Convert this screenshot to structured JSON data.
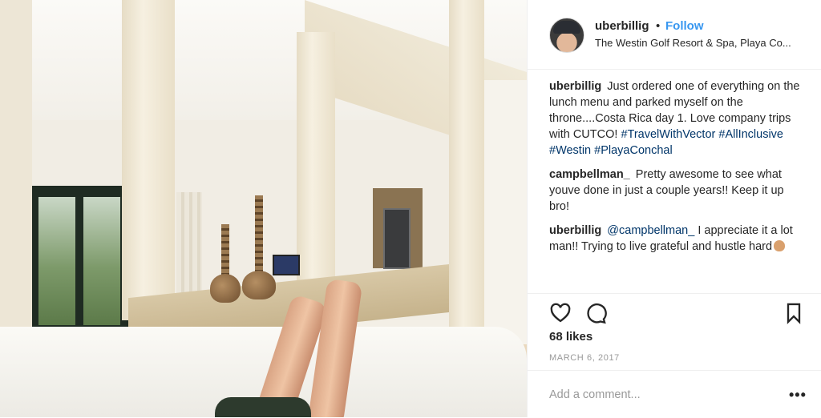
{
  "post": {
    "author": {
      "username": "uberbillig",
      "follow_label": "Follow",
      "location": "The Westin Golf Resort & Spa, Playa Co..."
    },
    "separator": "•",
    "caption": {
      "author": "uberbillig",
      "text": "Just ordered one of everything on the lunch menu and parked myself on the throne....Costa Rica day 1. Love company trips with CUTCO!",
      "hashtags": [
        "#TravelWithVector",
        "#AllInclusive",
        "#Westin",
        "#PlayaConchal"
      ]
    },
    "comments": [
      {
        "author": "campbellman_",
        "text": "Pretty awesome to see what youve done in just a couple years!! Keep it up bro!"
      },
      {
        "author": "uberbillig",
        "mention": "@campbellman_",
        "text": "I appreciate it a lot man!! Trying to live grateful and hustle hard",
        "emoji": "ok-hand-emoji"
      }
    ],
    "likes_text": "68 likes",
    "date_text": "MARCH 6, 2017",
    "add_comment_placeholder": "Add a comment...",
    "more_label": "•••",
    "icons": {
      "like": "heart-icon",
      "comment": "comment-icon",
      "save": "bookmark-icon"
    },
    "colors": {
      "follow": "#3897f0",
      "hashtag": "#003569",
      "meta": "#999999",
      "text": "#262626"
    }
  }
}
